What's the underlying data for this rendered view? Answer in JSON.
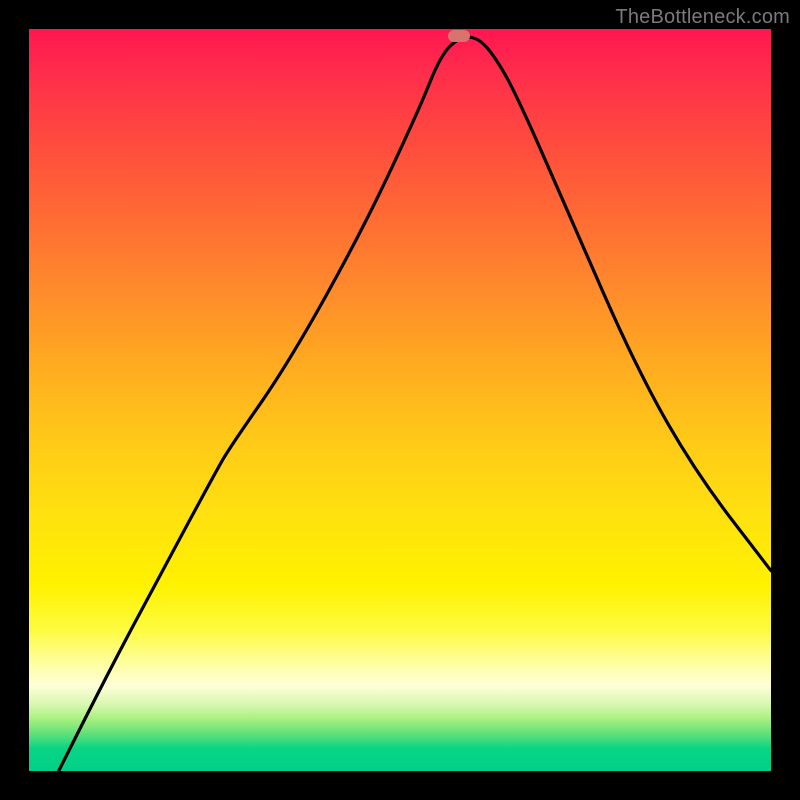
{
  "watermark": "TheBottleneck.com",
  "marker": {
    "color": "#d9736e",
    "x_pct": 58.0,
    "y_pct": 99.0
  },
  "chart_data": {
    "type": "line",
    "title": "",
    "xlabel": "",
    "ylabel": "",
    "x_range_pct": [
      0,
      100
    ],
    "y_range_pct": [
      0,
      100
    ],
    "gradient_orientation": "vertical",
    "gradient_meaning": "top=red (high mismatch) → bottom=green (optimal)",
    "annotations": [
      "watermark top-right"
    ],
    "series": [
      {
        "name": "bottleneck-curve",
        "style": "solid",
        "color": "#000000",
        "x_pct": [
          4.0,
          10.0,
          18.0,
          25.0,
          27.0,
          35.0,
          45.0,
          52.5,
          55.5,
          58.0,
          60.5,
          63.0,
          66.0,
          73.0,
          82.0,
          90.0,
          100.0
        ],
        "y_pct": [
          0.0,
          12.0,
          27.0,
          40.0,
          43.5,
          55.0,
          73.0,
          89.0,
          96.5,
          98.9,
          98.9,
          96.0,
          90.5,
          74.5,
          54.0,
          40.0,
          27.0
        ]
      }
    ],
    "optimal_point": {
      "x_pct": 58.0,
      "y_pct": 99.0
    }
  }
}
